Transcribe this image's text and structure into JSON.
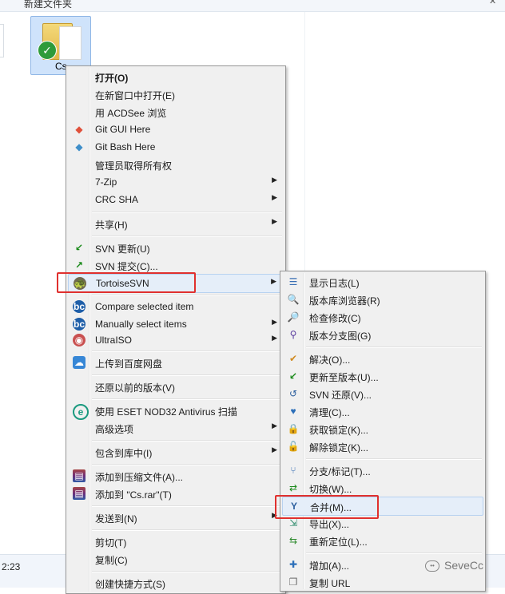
{
  "explorer": {
    "window_title_fragment": "新建文件夹",
    "status_time_fragment": "2:23",
    "folder_label": "Cs"
  },
  "main_menu": {
    "items": [
      {
        "label": "打开(O)",
        "icon": "",
        "submenu": false,
        "bold": true
      },
      {
        "label": "在新窗口中打开(E)",
        "icon": "",
        "submenu": false
      },
      {
        "label": "用 ACDSee 浏览",
        "icon": "",
        "submenu": false
      },
      {
        "label": "Git GUI Here",
        "icon": "git-gui-icon",
        "submenu": false
      },
      {
        "label": "Git Bash Here",
        "icon": "git-bash-icon",
        "submenu": false
      },
      {
        "label": "管理员取得所有权",
        "icon": "",
        "submenu": false
      },
      {
        "label": "7-Zip",
        "icon": "",
        "submenu": true
      },
      {
        "label": "CRC SHA",
        "icon": "",
        "submenu": true
      },
      {
        "label": "共享(H)",
        "icon": "",
        "submenu": true
      },
      {
        "label": "SVN 更新(U)",
        "icon": "svn-update-icon",
        "submenu": false
      },
      {
        "label": "SVN 提交(C)...",
        "icon": "svn-commit-icon",
        "submenu": false
      },
      {
        "label": "TortoiseSVN",
        "icon": "tortoisesvn-icon",
        "submenu": true
      },
      {
        "label": "Compare selected item",
        "icon": "beyond-compare-icon",
        "submenu": false
      },
      {
        "label": "Manually select items",
        "icon": "beyond-compare-icon",
        "submenu": true
      },
      {
        "label": "UltraISO",
        "icon": "ultraiso-icon",
        "submenu": true
      },
      {
        "label": "上传到百度网盘",
        "icon": "baidu-netdisk-icon",
        "submenu": false
      },
      {
        "label": "还原以前的版本(V)",
        "icon": "",
        "submenu": false
      },
      {
        "label": "使用 ESET NOD32 Antivirus 扫描",
        "icon": "eset-icon",
        "submenu": false
      },
      {
        "label": "高级选项",
        "icon": "",
        "submenu": true
      },
      {
        "label": "包含到库中(I)",
        "icon": "",
        "submenu": true
      },
      {
        "label": "添加到压缩文件(A)...",
        "icon": "winrar-icon",
        "submenu": false
      },
      {
        "label": "添加到 \"Cs.rar\"(T)",
        "icon": "winrar-icon",
        "submenu": false
      },
      {
        "label": "发送到(N)",
        "icon": "",
        "submenu": true
      },
      {
        "label": "剪切(T)",
        "icon": "",
        "submenu": false
      },
      {
        "label": "复制(C)",
        "icon": "",
        "submenu": false
      },
      {
        "label": "创建快捷方式(S)",
        "icon": "",
        "submenu": false
      }
    ]
  },
  "sub_menu": {
    "items": [
      {
        "label": "显示日志(L)",
        "icon": "show-log-icon"
      },
      {
        "label": "版本库浏览器(R)",
        "icon": "repo-browser-icon"
      },
      {
        "label": "检查修改(C)",
        "icon": "check-modifications-icon"
      },
      {
        "label": "版本分支图(G)",
        "icon": "revision-graph-icon"
      },
      {
        "label": "解决(O)...",
        "icon": "resolve-icon"
      },
      {
        "label": "更新至版本(U)...",
        "icon": "update-to-revision-icon"
      },
      {
        "label": "SVN 还原(V)...",
        "icon": "revert-icon"
      },
      {
        "label": "清理(C)...",
        "icon": "cleanup-icon"
      },
      {
        "label": "获取锁定(K)...",
        "icon": "get-lock-icon"
      },
      {
        "label": "解除锁定(K)...",
        "icon": "release-lock-icon"
      },
      {
        "label": "分支/标记(T)...",
        "icon": "branch-tag-icon"
      },
      {
        "label": "切换(W)...",
        "icon": "switch-icon"
      },
      {
        "label": "合并(M)...",
        "icon": "merge-icon"
      },
      {
        "label": "导出(X)...",
        "icon": "export-icon"
      },
      {
        "label": "重新定位(L)...",
        "icon": "relocate-icon"
      },
      {
        "label": "增加(A)...",
        "icon": "add-icon"
      },
      {
        "label": "复制 URL",
        "icon": "copy-url-icon"
      }
    ]
  },
  "watermark": {
    "text": "SeveCc"
  }
}
